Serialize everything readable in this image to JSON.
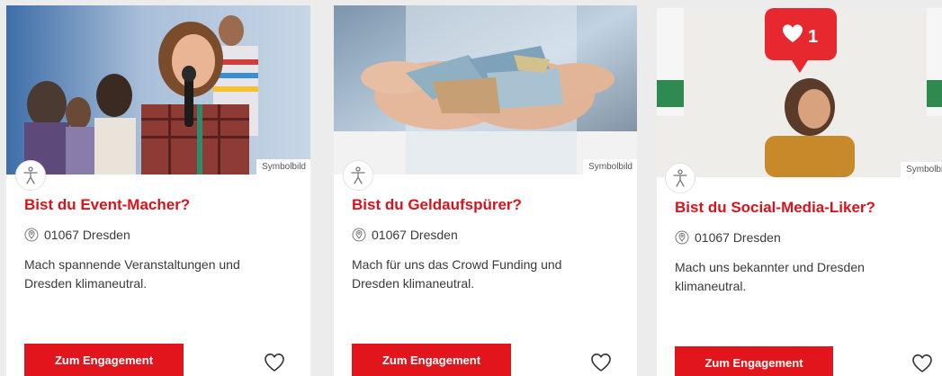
{
  "cards": [
    {
      "image_label": "Symbolbild",
      "accessibility_icon": "accessibility-person-icon",
      "title": "Bist du Event-Macher?",
      "location_icon": "map-pin-icon",
      "location": "01067 Dresden",
      "description": "Mach spannende Veranstaltungen und Dresden klimaneutral.",
      "cta_label": "Zum Engagement",
      "favorite_icon": "heart-outline-icon"
    },
    {
      "image_label": "Symbolbild",
      "accessibility_icon": "accessibility-person-icon",
      "title": "Bist du Geldaufspürer?",
      "location_icon": "map-pin-icon",
      "location": "01067 Dresden",
      "description": "Mach für uns das Crowd Funding und Dresden klimaneutral.",
      "cta_label": "Zum Engagement",
      "favorite_icon": "heart-outline-icon"
    },
    {
      "image_label": "Symbolbild",
      "accessibility_icon": "accessibility-person-icon",
      "title": "Bist du Social-Media-Liker?",
      "location_icon": "map-pin-icon",
      "location": "01067 Dresden",
      "description": "Mach uns bekannter und Dresden klimaneutral.",
      "cta_label": "Zum Engagement",
      "favorite_icon": "heart-outline-icon",
      "like_count": "1"
    }
  ],
  "colors": {
    "accent": "#e3151c",
    "title": "#d9131b",
    "text": "#3a3a3a",
    "background": "#ececec",
    "card": "#ffffff"
  }
}
